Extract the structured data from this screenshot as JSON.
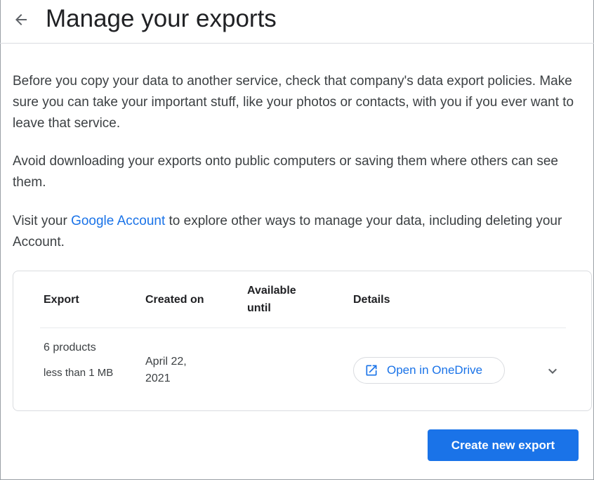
{
  "header": {
    "title": "Manage your exports",
    "back_icon": "arrow-left-icon"
  },
  "intro": {
    "paragraph1": "Before you copy your data to another service, check that company's data export policies. Make sure you can take your important stuff, like your photos or contacts, with you if you ever want to leave that service.",
    "paragraph2": "Avoid downloading your exports onto public computers or saving them where others can see them.",
    "paragraph3_before": "Visit your ",
    "paragraph3_link": "Google Account",
    "paragraph3_after": " to explore other ways to manage your data, including deleting your Account."
  },
  "table": {
    "headers": {
      "export": "Export",
      "created_on": "Created on",
      "available_until": "Available until",
      "details": "Details"
    },
    "rows": [
      {
        "products": "6 products",
        "size": "less than 1 MB",
        "created_on": "April 22, 2021",
        "available_until": "",
        "details_button": "Open in OneDrive",
        "details_icon": "open-in-new-icon",
        "expand_icon": "chevron-down-icon"
      }
    ]
  },
  "actions": {
    "create_label": "Create new export"
  },
  "colors": {
    "accent": "#1a73e8",
    "text": "#202124",
    "muted_text": "#3c4043",
    "border": "#dadce0"
  }
}
